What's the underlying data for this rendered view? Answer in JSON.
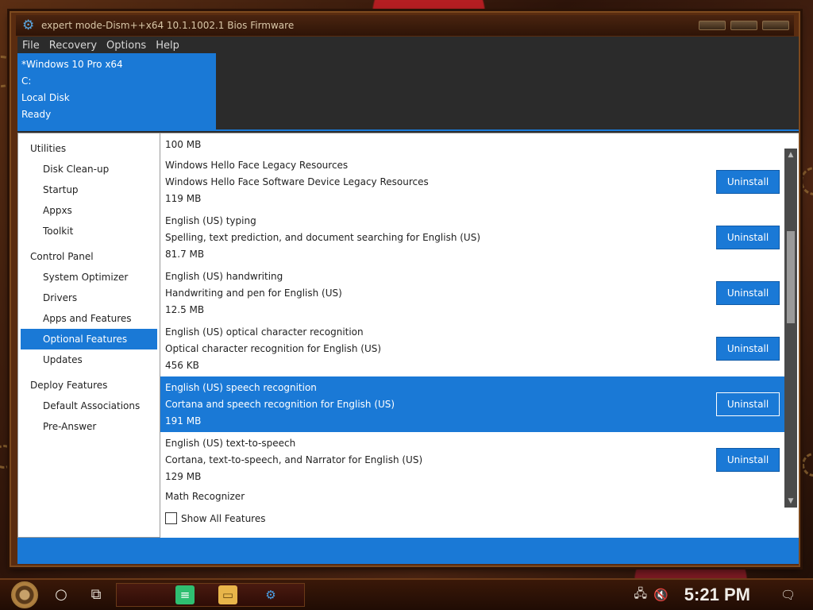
{
  "window": {
    "title": "expert mode-Dism++x64 10.1.1002.1 Bios Firmware",
    "accent_color": "#1a79d6"
  },
  "menu": [
    "File",
    "Recovery",
    "Options",
    "Help"
  ],
  "image_info": [
    "*Windows 10 Pro x64",
    "C:",
    "Local Disk",
    "Ready"
  ],
  "sidebar": [
    {
      "label": "Utilities",
      "type": "group"
    },
    {
      "label": "Disk Clean-up",
      "type": "item"
    },
    {
      "label": "Startup",
      "type": "item"
    },
    {
      "label": "Appxs",
      "type": "item"
    },
    {
      "label": "Toolkit",
      "type": "item"
    },
    {
      "label": "Control Panel",
      "type": "group"
    },
    {
      "label": "System Optimizer",
      "type": "item"
    },
    {
      "label": "Drivers",
      "type": "item"
    },
    {
      "label": "Apps and Features",
      "type": "item"
    },
    {
      "label": "Optional Features",
      "type": "item",
      "active": true
    },
    {
      "label": "Updates",
      "type": "item"
    },
    {
      "label": "Deploy Features",
      "type": "group"
    },
    {
      "label": "Default Associations",
      "type": "item"
    },
    {
      "label": "Pre-Answer",
      "type": "item"
    }
  ],
  "features": {
    "partial_top_size": "100 MB",
    "items": [
      {
        "name": "Windows Hello Face Legacy Resources",
        "description": "Windows Hello Face Software Device Legacy Resources",
        "size": "119 MB"
      },
      {
        "name": "English (US) typing",
        "description": "Spelling, text prediction, and document searching for English (US)",
        "size": "81.7 MB"
      },
      {
        "name": "English (US) handwriting",
        "description": "Handwriting and pen for English (US)",
        "size": "12.5 MB"
      },
      {
        "name": "English (US) optical character recognition",
        "description": "Optical character recognition for English (US)",
        "size": "456 KB"
      },
      {
        "name": "English (US) speech recognition",
        "description": "Cortana and speech recognition for English (US)",
        "size": "191 MB",
        "selected": true
      },
      {
        "name": "English (US) text-to-speech",
        "description": "Cortana, text-to-speech, and Narrator for English (US)",
        "size": "129 MB"
      }
    ],
    "partial_bottom_name": "Math Recognizer",
    "uninstall_label": "Uninstall",
    "show_all_label": "Show All Features"
  },
  "taskbar": {
    "clock": "5:21 PM",
    "apps": [
      {
        "icon": "notes-icon",
        "color": "#2fbf71"
      },
      {
        "icon": "file-explorer-icon",
        "color": "#e8b54a"
      },
      {
        "icon": "dism-gear-icon",
        "color": "#4aa0e6"
      }
    ]
  }
}
